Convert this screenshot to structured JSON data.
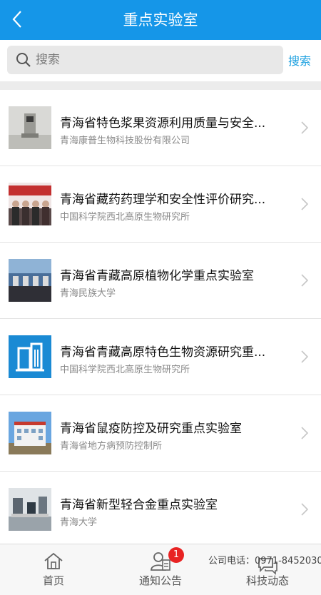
{
  "header": {
    "title": "重点实验室"
  },
  "search": {
    "placeholder": "搜索",
    "button_label": "搜索"
  },
  "items": [
    {
      "title": "青海省特色浆果资源利用质量与安全...",
      "subtitle": "青海康普生物科技股份有限公司",
      "thumb": "lab-equipment"
    },
    {
      "title": "青海省藏药药理学和安全性评价研究...",
      "subtitle": "中国科学院西北高原生物研究所",
      "thumb": "group-photo"
    },
    {
      "title": "青海省青藏高原植物化学重点实验室",
      "subtitle": "青海民族大学",
      "thumb": "lab-bench"
    },
    {
      "title": "青海省青藏高原特色生物资源研究重...",
      "subtitle": "中国科学院西北高原生物研究所",
      "thumb": "building-icon"
    },
    {
      "title": "青海省鼠疫防控及研究重点实验室",
      "subtitle": "青海省地方病预防控制所",
      "thumb": "building-photo"
    },
    {
      "title": "青海省新型轻合金重点实验室",
      "subtitle": "青海大学",
      "thumb": "lab-room"
    }
  ],
  "tabbar": {
    "home_label": "首页",
    "notice_label": "通知公告",
    "notice_badge": "1",
    "news_label": "科技动态",
    "phone_text": "公司电话：0971-8452030"
  },
  "colors": {
    "header": "#1596e8",
    "accent": "#1ea1e0",
    "badge": "#e82323"
  }
}
